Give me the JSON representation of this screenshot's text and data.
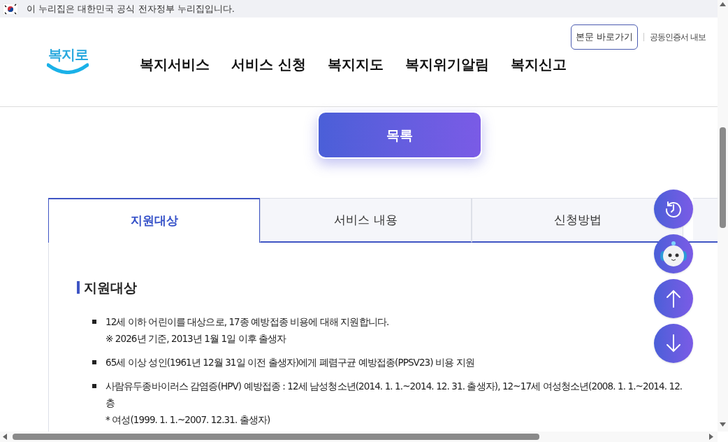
{
  "gov_banner": {
    "text": "이 누리집은 대한민국 공식 전자정부 누리집입니다."
  },
  "header": {
    "logo": "복지로",
    "skip_link": "본문 바로가기",
    "util_link": "공동인증서 내보",
    "nav": [
      "복지서비스",
      "서비스 신청",
      "복지지도",
      "복지위기알림",
      "복지신고"
    ]
  },
  "list_button": "목록",
  "tabs": [
    {
      "label": "지원대상",
      "selected": true
    },
    {
      "label": "서비스 내용",
      "selected": false
    },
    {
      "label": "신청방법",
      "selected": false
    }
  ],
  "section": {
    "heading": "지원대상",
    "items": [
      {
        "lines": [
          "12세 이하 어린이를 대상으로, 17종 예방접종 비용에 대해 지원합니다.",
          "※ 2026년 기준, 2013년 1월 1일 이후 출생자"
        ]
      },
      {
        "lines": [
          "65세 이상 성인(1961년 12월 31일 이전 출생자)에게 폐렴구균 예방접종(PPSV23) 비용 지원"
        ]
      },
      {
        "lines": [
          "사람유두종바이러스 감염증(HPV) 예방접종 : 12세 남성청소년(2014. 1. 1.~2014. 12. 31. 출생자), 12~17세 여성청소년(2008. 1. 1.~2014. 12.",
          "층",
          "* 여성(1999. 1. 1.~2007. 12.31. 출생자)"
        ]
      }
    ]
  },
  "floating_buttons": [
    {
      "kind": "history"
    },
    {
      "kind": "chatbot"
    },
    {
      "kind": "up"
    },
    {
      "kind": "down"
    }
  ]
}
